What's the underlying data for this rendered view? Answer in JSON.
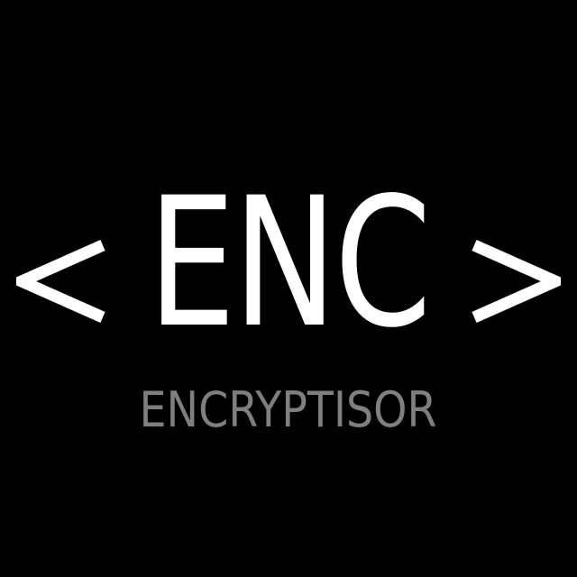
{
  "logo": {
    "mark": "ENC",
    "wordmark": "ENCRYPTISOR",
    "left_bracket_icon": "less-than-chevron-icon",
    "right_bracket_icon": "greater-than-chevron-icon"
  },
  "colors": {
    "background": "#000000",
    "mark": "#ffffff",
    "wordmark": "#7f7f7f"
  }
}
